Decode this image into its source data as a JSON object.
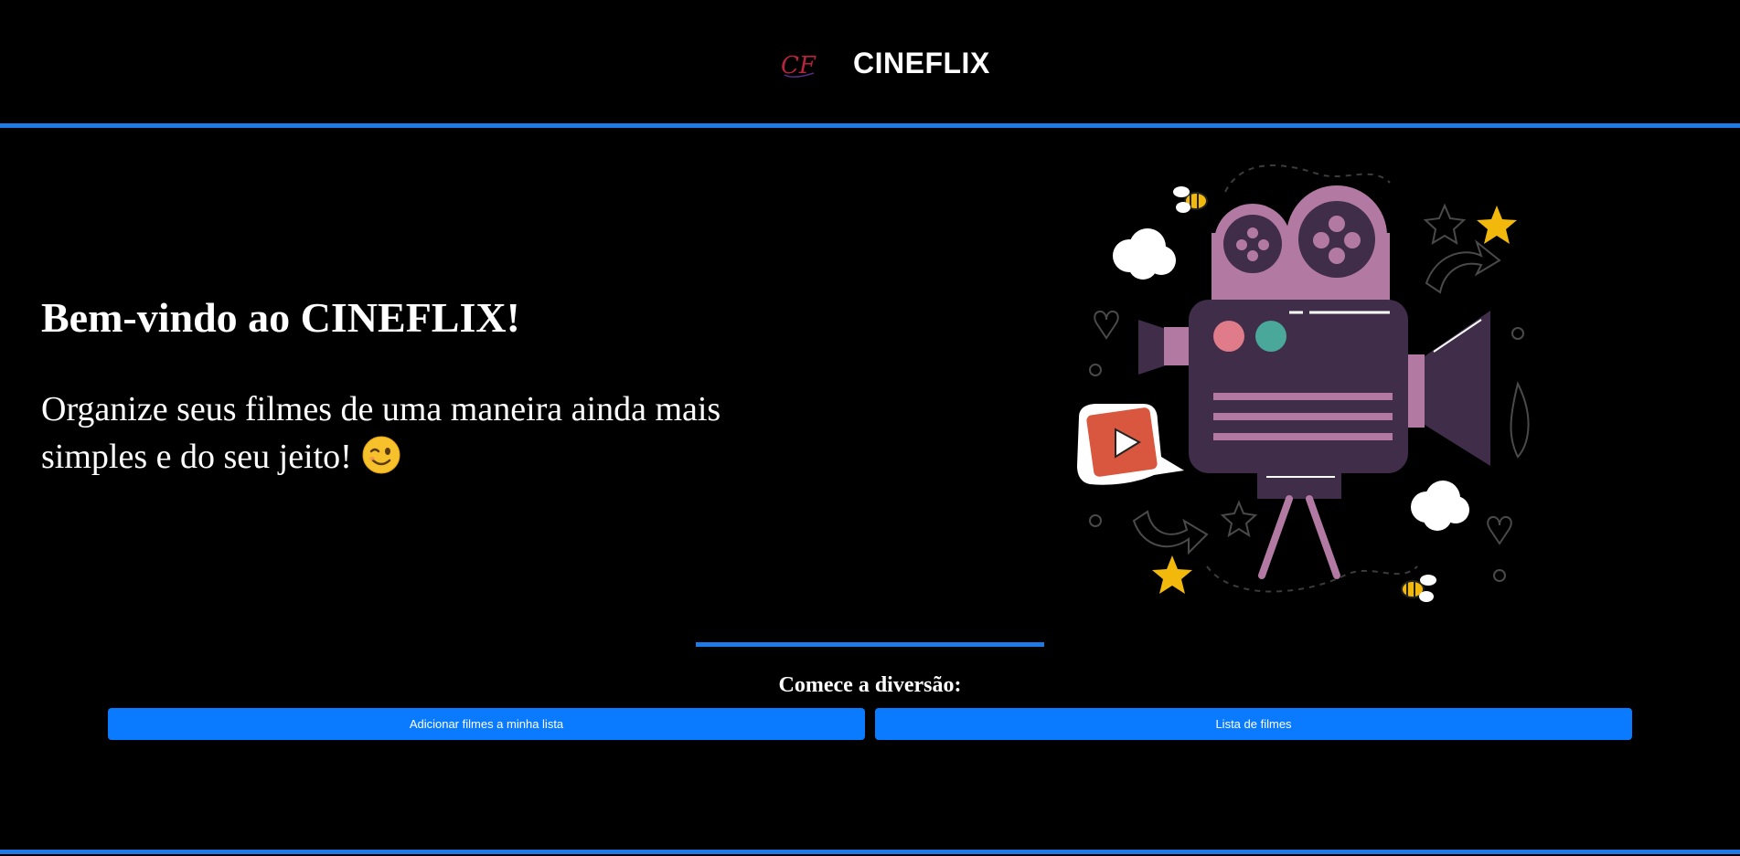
{
  "header": {
    "logo_text": "CF",
    "brand": "CINEFLIX"
  },
  "hero": {
    "title": "Bem-vindo ao CINEFLIX!",
    "subtitle": "Organize seus filmes de uma maneira ainda mais simples e do seu jeito!",
    "emoji_icon": "winking-face-icon"
  },
  "illustration": {
    "icon": "film-camera-illustration"
  },
  "cta": {
    "heading": "Comece a diversão:",
    "add_button_label": "Adicionar filmes a minha lista",
    "list_button_label": "Lista de filmes"
  },
  "colors": {
    "background": "#000000",
    "accent_line": "#1e7ae6",
    "button": "#0a7bff",
    "camera_dark": "#3f2d4a",
    "camera_light": "#b27aa3",
    "star_yellow": "#f2b90c",
    "play_red": "#d9573f"
  }
}
